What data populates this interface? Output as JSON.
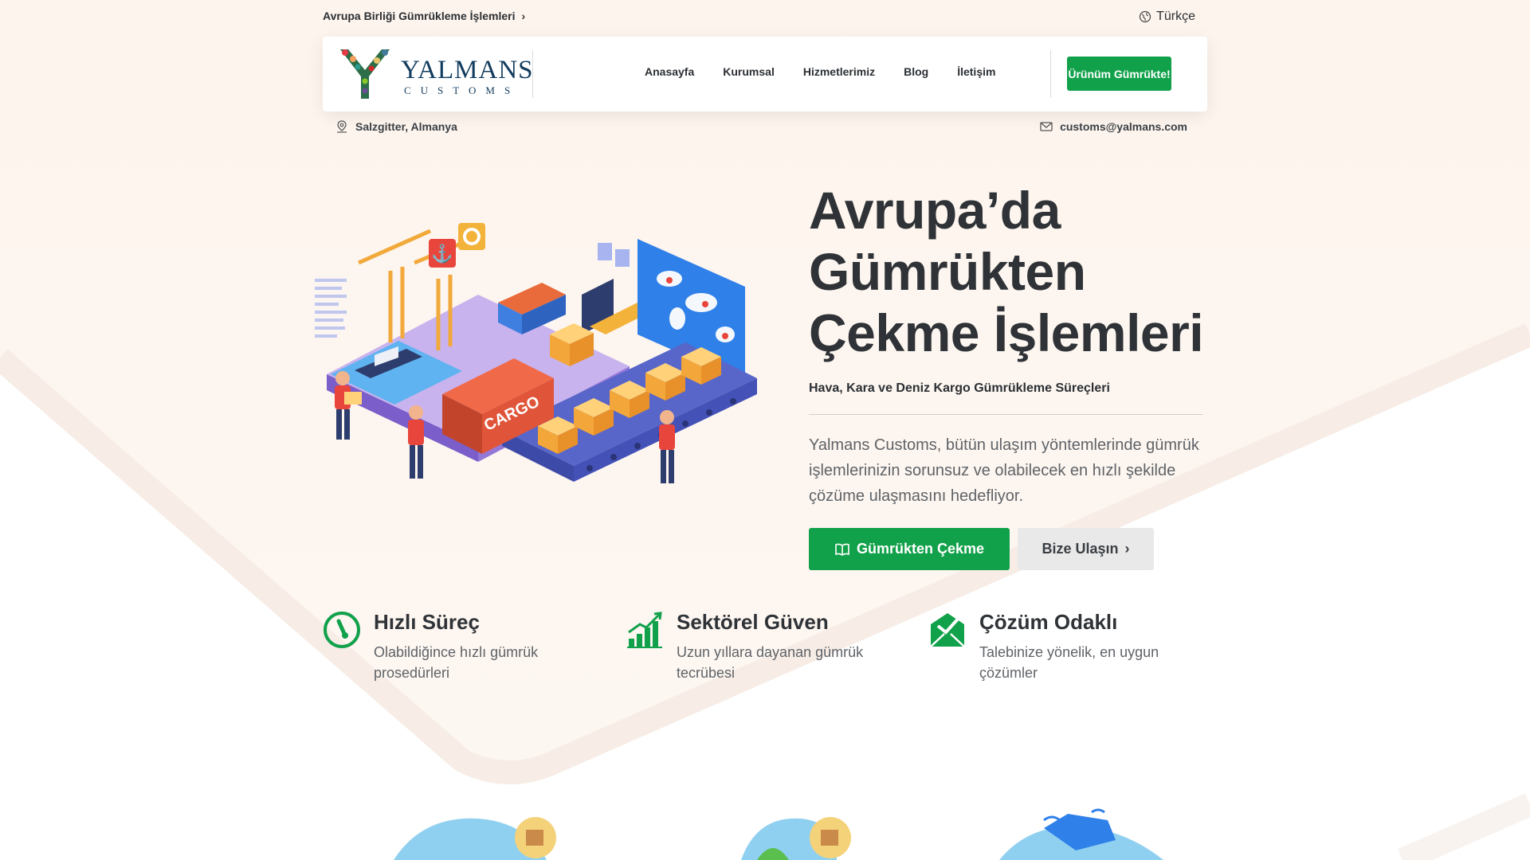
{
  "topbar": {
    "breadcrumb": "Avrupa Birliği Gümrükleme İşlemleri",
    "breadcrumb_icon": "chevron-right-icon",
    "language": "Türkçe",
    "language_icon": "globe-icon"
  },
  "header": {
    "logo_text": "YALMANS",
    "logo_subtext": "CUSTOMS",
    "nav": [
      "Anasayfa",
      "Kurumsal",
      "Hizmetlerimiz",
      "Blog",
      "İletişim"
    ],
    "cta": "Ürünüm Gümrükte!"
  },
  "info": {
    "location": "Salzgitter, Almanya",
    "location_icon": "map-pin-icon",
    "email": "customs@yalmans.com",
    "email_icon": "mail-icon"
  },
  "hero": {
    "title_lines": [
      "Avrupa’da",
      "Gümrükten",
      "Çekme İşlemleri"
    ],
    "subtitle": "Hava, Kara ve Deniz Kargo Gümrükleme Süreçleri",
    "description": "Yalmans Customs, bütün ulaşım yöntemlerinde gümrük işlemlerinizin sorunsuz ve olabilecek en hızlı şekilde çözüme ulaşmasını hedefliyor.",
    "illustration_text": "CARGO",
    "primary_button": "Gümrükten Çekme",
    "primary_button_icon": "book-icon",
    "secondary_button": "Bize Ulaşın",
    "secondary_button_icon": "chevron-right-icon"
  },
  "features": [
    {
      "title": "Hızlı Süreç",
      "description": "Olabildiğince hızlı gümrük prosedürleri",
      "icon": "speedometer-icon"
    },
    {
      "title": "Sektörel Güven",
      "description": "Uzun yıllara dayanan gümrük tecrübesi",
      "icon": "bar-chart-icon"
    },
    {
      "title": "Çözüm Odaklı",
      "description": "Talebinize yönelik, en uygun çözümler",
      "icon": "envelope-check-icon"
    }
  ],
  "colors": {
    "brand_green": "#12a14b",
    "title_dark": "#2f3337",
    "body_gray": "#5f6368",
    "bg_peach": "#fdf3ec"
  }
}
